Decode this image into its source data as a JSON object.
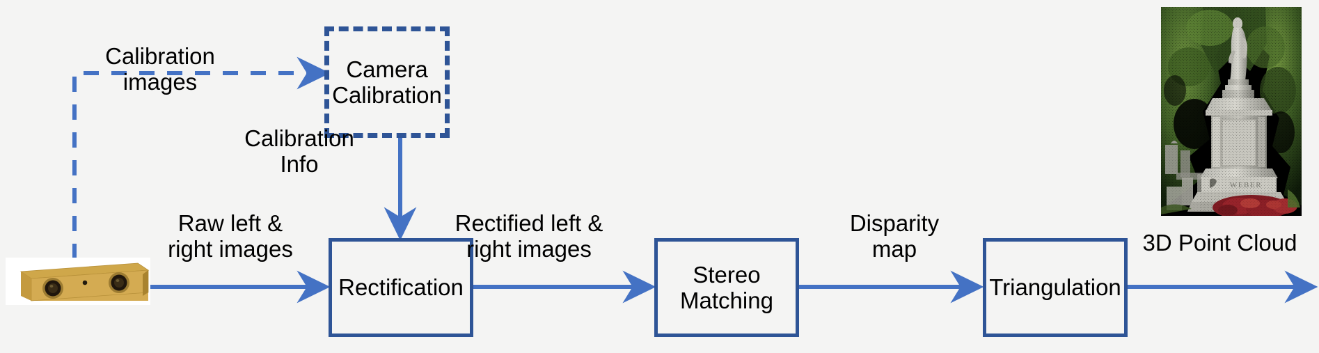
{
  "diagram": {
    "title": "Stereo vision 3D reconstruction pipeline",
    "colors": {
      "background": "#f4f4f3",
      "box_border": "#2e5496",
      "arrow": "#4472c4",
      "dashed_arrow": "#4472c4",
      "text": "#000000"
    },
    "nodes": [
      {
        "id": "camera-calibration",
        "label": "Camera\nCalibration",
        "style": "dashed"
      },
      {
        "id": "rectification",
        "label": "Rectification",
        "style": "solid"
      },
      {
        "id": "stereo-matching",
        "label": "Stereo\nMatching",
        "style": "solid"
      },
      {
        "id": "triangulation",
        "label": "Triangulation",
        "style": "solid"
      }
    ],
    "edge_labels": [
      {
        "id": "calibration-images",
        "text": "Calibration\nimages"
      },
      {
        "id": "calibration-info",
        "text": "Calibration\nInfo"
      },
      {
        "id": "raw-images",
        "text": "Raw left &\nright images"
      },
      {
        "id": "rectified-images",
        "text": "Rectified left &\nright images"
      },
      {
        "id": "disparity-map",
        "text": "Disparity\nmap"
      },
      {
        "id": "point-cloud-out",
        "text": "3D Point Cloud"
      }
    ],
    "images": [
      {
        "id": "stereo-camera",
        "caption": "stereo camera device (gold housing, two lenses)"
      },
      {
        "id": "point-cloud-result",
        "caption": "3D point cloud of a cemetery monument inscribed WEBER"
      }
    ]
  }
}
